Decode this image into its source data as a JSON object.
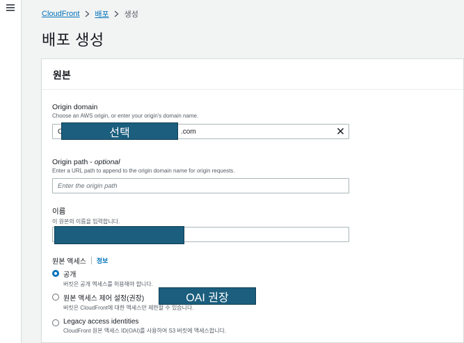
{
  "nav": {
    "menu_icon": "hamburger-menu-icon"
  },
  "breadcrumb": {
    "items": [
      "CloudFront",
      "배포",
      "생성"
    ],
    "separator_icon": "chevron-right-icon"
  },
  "page": {
    "title": "배포 생성"
  },
  "origin_panel": {
    "header": "원본",
    "origin_domain": {
      "label": "Origin domain",
      "description": "Choose an AWS origin, or enter your origin's domain name.",
      "value_prefix": "C",
      "value_suffix": ".com",
      "redaction_label": "선택",
      "clear_icon": "close-icon"
    },
    "origin_path": {
      "label": "Origin path - ",
      "label_optional": "optional",
      "description": "Enter a URL path to append to the origin domain name for origin requests.",
      "placeholder": "Enter the origin path"
    },
    "name": {
      "label": "이름",
      "description": "이 원본의 이름을 입력합니다."
    },
    "origin_access": {
      "label": "원본 액세스",
      "info_link": "정보",
      "options": [
        {
          "title": "공개",
          "description": "버킷은 공개 액세스를 허용해야 합니다.",
          "selected": true
        },
        {
          "title": "원본 액세스 제어 설정(권장)",
          "description": "버킷은 CloudFront에 대한 액세스만 제한할 수 있습니다.",
          "selected": false
        },
        {
          "title": "Legacy access identities",
          "description": "CloudFront 원본 액세스 ID(OAI)를 사용하여 S3 버킷에 액세스합니다.",
          "selected": false
        }
      ],
      "annotation": "OAI 권장"
    }
  },
  "colors": {
    "link": "#0073bb",
    "redaction": "#1b5e7e",
    "panel_bg": "#ffffff",
    "page_bg": "#f2f3f3"
  }
}
